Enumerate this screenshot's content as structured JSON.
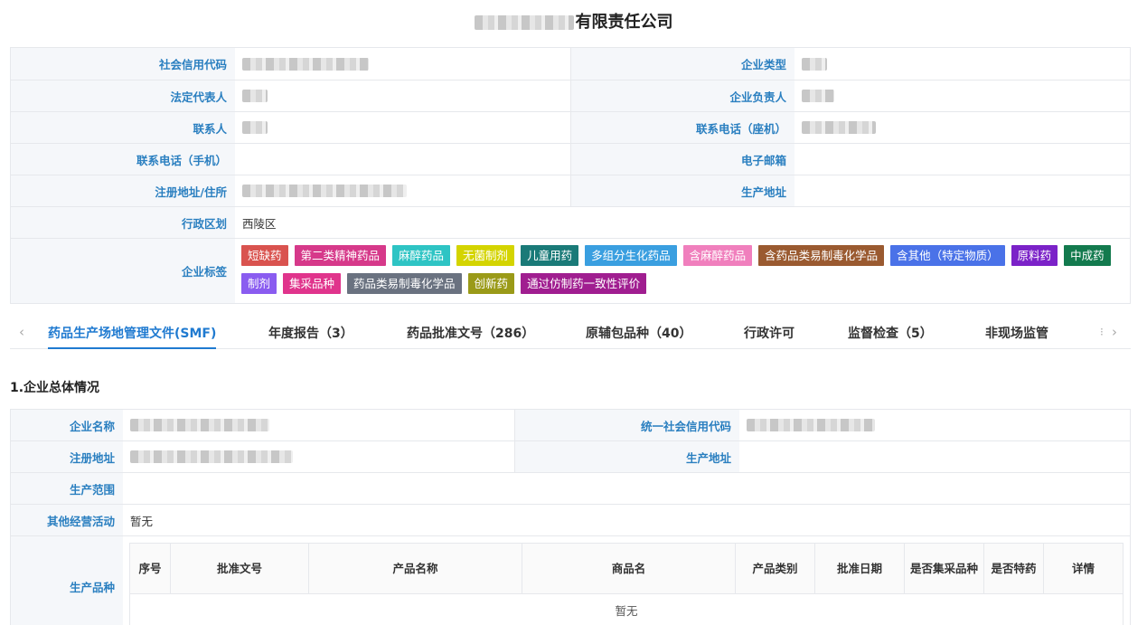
{
  "page": {
    "title_suffix": "有限责任公司"
  },
  "info": {
    "credit_code_label": "社会信用代码",
    "company_type_label": "企业类型",
    "legal_rep_label": "法定代表人",
    "company_head_label": "企业负责人",
    "contact_label": "联系人",
    "landline_label": "联系电话（座机）",
    "mobile_label": "联系电话（手机）",
    "email_label": "电子邮箱",
    "reg_address_label": "注册地址/住所",
    "prod_address_label": "生产地址",
    "district_label": "行政区划",
    "district_value": "西陵区",
    "tags_label": "企业标签"
  },
  "tags": [
    {
      "text": "短缺药",
      "color": "#d9534f"
    },
    {
      "text": "第二类精神药品",
      "color": "#d6398a"
    },
    {
      "text": "麻醉药品",
      "color": "#2ec4c4"
    },
    {
      "text": "无菌制剂",
      "color": "#d4d400"
    },
    {
      "text": "儿童用药",
      "color": "#1a7a78"
    },
    {
      "text": "多组分生化药品",
      "color": "#3a9fe0"
    },
    {
      "text": "含麻醉药品",
      "color": "#f07fbd"
    },
    {
      "text": "含药品类易制毒化学品",
      "color": "#9a5a30"
    },
    {
      "text": "含其他（特定物质）",
      "color": "#4a72e8"
    },
    {
      "text": "原料药",
      "color": "#7b22c8"
    },
    {
      "text": "中成药",
      "color": "#137a4e"
    },
    {
      "text": "制剂",
      "color": "#8a5cf0"
    },
    {
      "text": "集采品种",
      "color": "#e0348c"
    },
    {
      "text": "药品类易制毒化学品",
      "color": "#6a7280"
    },
    {
      "text": "创新药",
      "color": "#9a9a18"
    },
    {
      "text": "通过仿制药一致性评价",
      "color": "#a01e90"
    }
  ],
  "tabs": [
    {
      "label": "药品生产场地管理文件(SMF)",
      "active": true
    },
    {
      "label": "年度报告（3）"
    },
    {
      "label": "药品批准文号（286）"
    },
    {
      "label": "原辅包品种（40）"
    },
    {
      "label": "行政许可"
    },
    {
      "label": "监督检查（5）"
    },
    {
      "label": "非现场监管"
    }
  ],
  "tab_nav": {
    "prev": "‹",
    "next": "›"
  },
  "section": {
    "title": "1.企业总体情况"
  },
  "overview": {
    "name_label": "企业名称",
    "credit_label": "统一社会信用代码",
    "reg_label": "注册地址",
    "prod_label": "生产地址",
    "scope_label": "生产范围",
    "other_label": "其他经营活动",
    "other_value": "暂无",
    "varieties_label": "生产品种"
  },
  "varieties_table": {
    "headers": [
      "序号",
      "批准文号",
      "产品名称",
      "商品名",
      "产品类别",
      "批准日期",
      "是否集采品种",
      "是否特药",
      "详情"
    ],
    "empty_text": "暂无"
  }
}
